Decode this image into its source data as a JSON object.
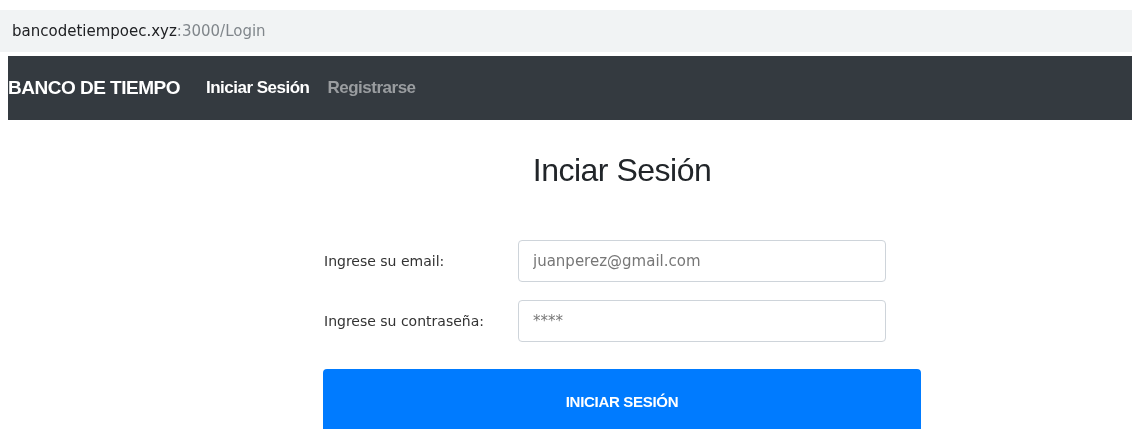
{
  "address_bar": {
    "host": "bancodetiempoec.xyz",
    "path": ":3000/Login"
  },
  "navbar": {
    "brand": "BANCO DE TIEMPO",
    "links": [
      {
        "label": "Iniciar Sesión",
        "selected": true
      },
      {
        "label": "Registrarse",
        "selected": false
      }
    ]
  },
  "form": {
    "title": "Inciar Sesión",
    "fields": [
      {
        "label": "Ingrese su email:",
        "placeholder": "juanperez@gmail.com"
      },
      {
        "label": "Ingrese su contraseña:",
        "placeholder": "****"
      }
    ],
    "submit": "INICIAR SESIÓN"
  }
}
